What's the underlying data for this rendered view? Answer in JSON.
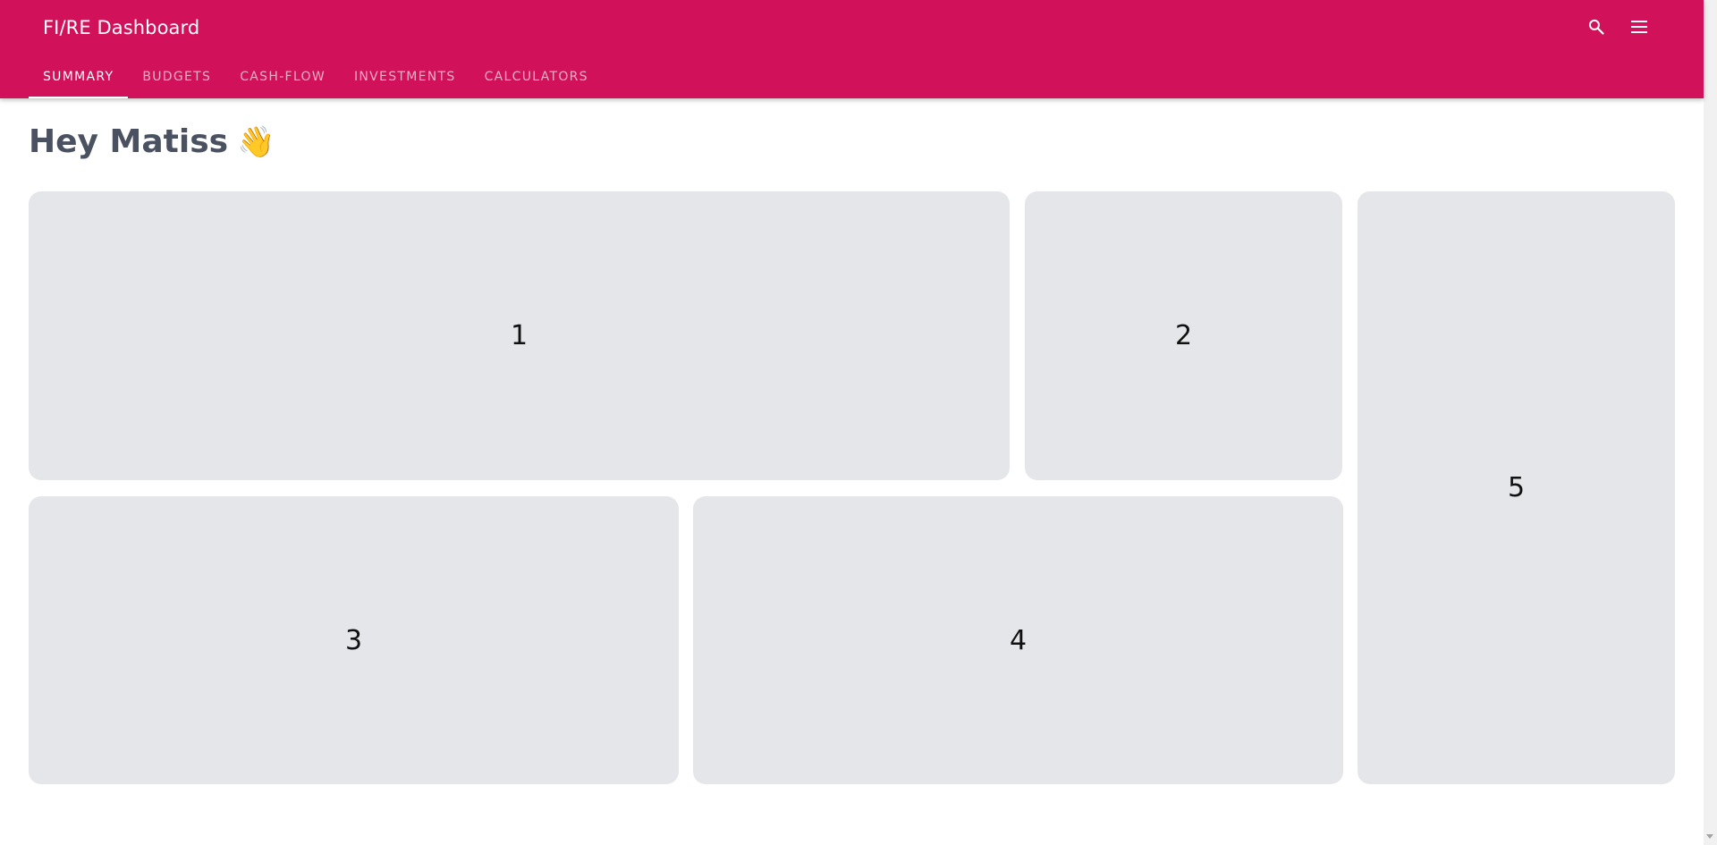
{
  "header": {
    "title": "FI/RE Dashboard",
    "search_icon": "search-icon",
    "menu_icon": "menu-icon",
    "color": "#d1125b"
  },
  "tabs": [
    {
      "label": "SUMMARY",
      "active": true
    },
    {
      "label": "BUDGETS",
      "active": false
    },
    {
      "label": "CASH-FLOW",
      "active": false
    },
    {
      "label": "INVESTMENTS",
      "active": false
    },
    {
      "label": "CALCULATORS",
      "active": false
    }
  ],
  "greeting": {
    "text": "Hey Matiss",
    "emoji": "👋"
  },
  "cards": [
    {
      "label": "1"
    },
    {
      "label": "2"
    },
    {
      "label": "3"
    },
    {
      "label": "4"
    },
    {
      "label": "5"
    }
  ]
}
